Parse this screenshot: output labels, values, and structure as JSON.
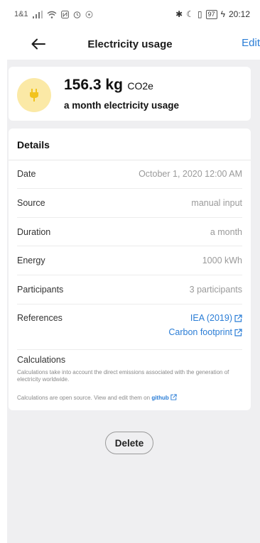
{
  "status_bar": {
    "carrier": "1&1",
    "time": "20:12",
    "battery": "97"
  },
  "header": {
    "title": "Electricity usage",
    "edit_label": "Edit"
  },
  "summary": {
    "amount": "156.3 kg",
    "unit": "CO2e",
    "subtitle": "a month electricity usage",
    "icon_color": "#f2c31c",
    "icon_bg": "#fbe9a6"
  },
  "details": {
    "title": "Details",
    "rows": [
      {
        "label": "Date",
        "value": "October 1, 2020 12:00 AM"
      },
      {
        "label": "Source",
        "value": "manual input"
      },
      {
        "label": "Duration",
        "value": "a month"
      },
      {
        "label": "Energy",
        "value": "1000 kWh"
      },
      {
        "label": "Participants",
        "value": "3 participants"
      }
    ],
    "references_label": "References",
    "references": [
      {
        "label": "IEA (2019)",
        "icon": "external-link-icon"
      },
      {
        "label": "Carbon footprint",
        "icon": "external-link-icon"
      }
    ],
    "calculations_title": "Calculations",
    "calculations_text": "Calculations take into account the direct emissions associated with the generation of electricity worldwide.",
    "open_source_text": "Calculations are open source. View and edit them on",
    "github_label": "github"
  },
  "delete_label": "Delete",
  "colors": {
    "accent": "#2a7dd6",
    "background": "#efeff1"
  }
}
